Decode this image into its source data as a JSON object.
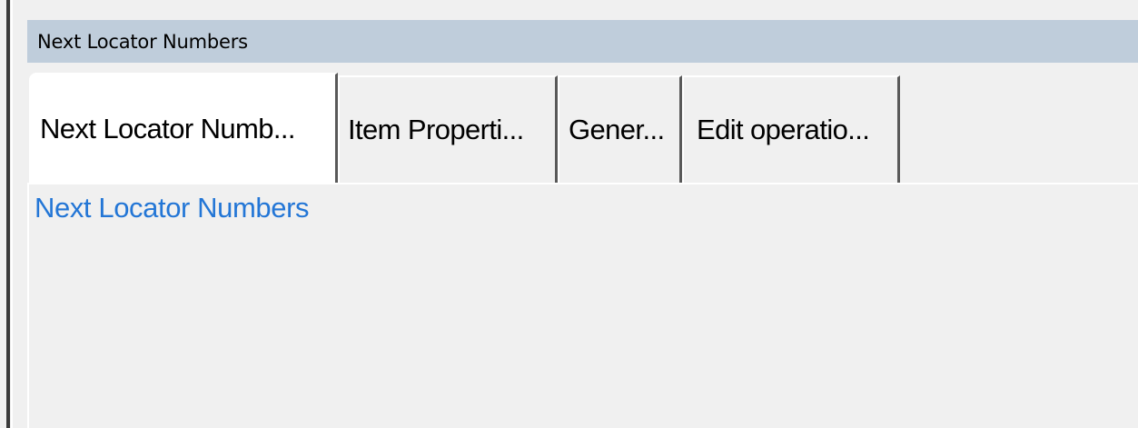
{
  "panel": {
    "title": "Next Locator Numbers"
  },
  "tabs": [
    {
      "label": "Next Locator Numb...",
      "active": true
    },
    {
      "label": "Item Properti...",
      "active": false
    },
    {
      "label": "Gener...",
      "active": false
    },
    {
      "label": "Edit operatio...",
      "active": false
    }
  ],
  "content": {
    "heading": "Next Locator Numbers"
  },
  "colors": {
    "header_bg": "#bfcddb",
    "link_blue": "#2376d6",
    "window_bg": "#f0f0f0"
  }
}
